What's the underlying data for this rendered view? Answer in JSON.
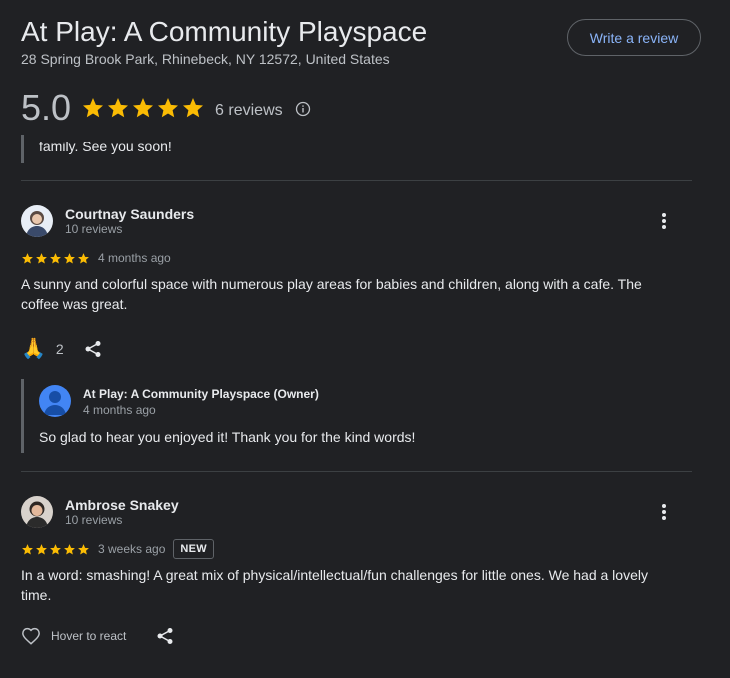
{
  "header": {
    "business_name": "At Play: A Community Playspace",
    "address": "28 Spring Brook Park, Rhinebeck, NY 12572, United States",
    "write_review_label": "Write a review"
  },
  "summary": {
    "rating": "5.0",
    "star_fraction": 1.0,
    "review_count": "6 reviews"
  },
  "previous": {
    "reply_tail": "family. See you soon!"
  },
  "reviews": [
    {
      "name": "Courtnay Saunders",
      "meta": "10 reviews",
      "stars": 5,
      "time": "4 months ago",
      "text": "A sunny and colorful space with numerous play areas for babies and children, along with a cafe. The coffee was great.",
      "reaction": "🙏",
      "reaction_count": "2",
      "owner_reply": {
        "name": "At Play: A Community Playspace (Owner)",
        "time": "4 months ago",
        "text": "So glad to hear you enjoyed it! Thank you for the kind words!"
      }
    },
    {
      "name": "Ambrose Snakey",
      "meta": "10 reviews",
      "stars": 5,
      "time": "3 weeks ago",
      "badge": "NEW",
      "text": "In a word: smashing! A great mix of physical/intellectual/fun challenges for little ones. We had a lovely time.",
      "hover_react": "Hover to react"
    }
  ],
  "colors": {
    "star": "#fbbc04",
    "link": "#8ab4f8",
    "bg": "#202124"
  }
}
